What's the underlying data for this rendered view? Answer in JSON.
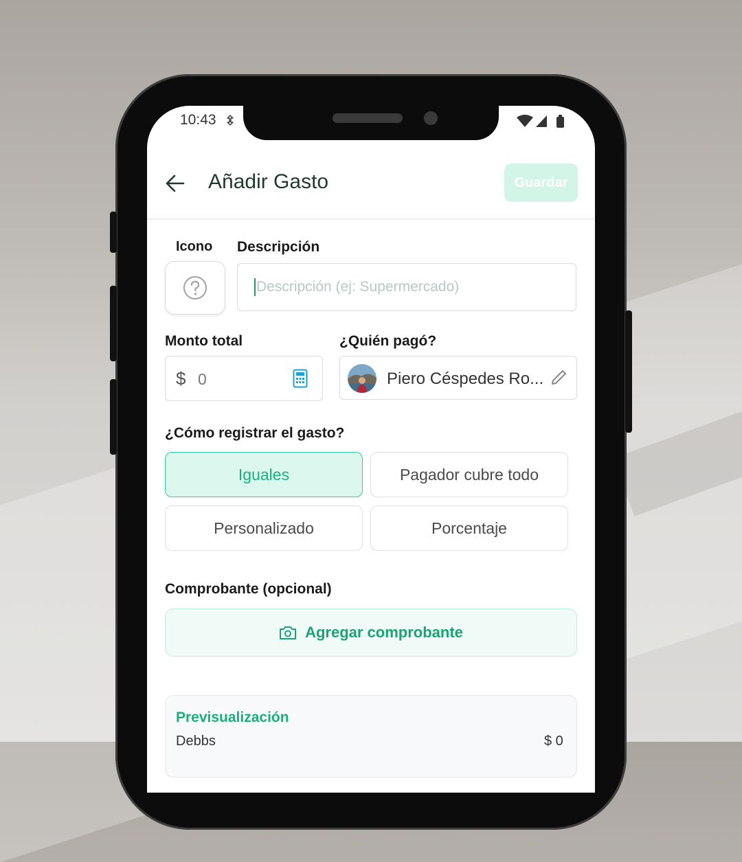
{
  "status_bar": {
    "time": "10:43",
    "left_icon": "location-sync-icon",
    "right_icons": [
      "wifi-icon",
      "signal-icon",
      "battery-icon"
    ]
  },
  "header": {
    "title": "Añadir Gasto",
    "back_icon": "arrow-left-icon",
    "save_label": "Guardar"
  },
  "form": {
    "icon_label": "Icono",
    "icon_placeholder": "question-circle-icon",
    "description_label": "Descripción",
    "description_placeholder": "Descripción (ej: Supermercado)",
    "description_value": "",
    "amount_label": "Monto total",
    "currency_symbol": "$",
    "amount_value": "0",
    "payer_label": "¿Quién pagó?",
    "payer_name": "Piero Céspedes Ro...",
    "split_label": "¿Cómo registrar el gasto?",
    "split_options": [
      {
        "label": "Iguales",
        "selected": true
      },
      {
        "label": "Pagador cubre todo",
        "selected": false
      },
      {
        "label": "Personalizado",
        "selected": false
      },
      {
        "label": "Porcentaje",
        "selected": false
      }
    ],
    "receipt_label": "Comprobante (opcional)",
    "receipt_button": "Agregar comprobante"
  },
  "preview": {
    "title": "Previsualización",
    "row_label": "Debbs",
    "row_value": "$ 0"
  },
  "colors": {
    "accent": "#18b07a",
    "accent_light": "#dcf7ed",
    "title": "#1f3a2d",
    "save_disabled": "#d3f5e8"
  }
}
